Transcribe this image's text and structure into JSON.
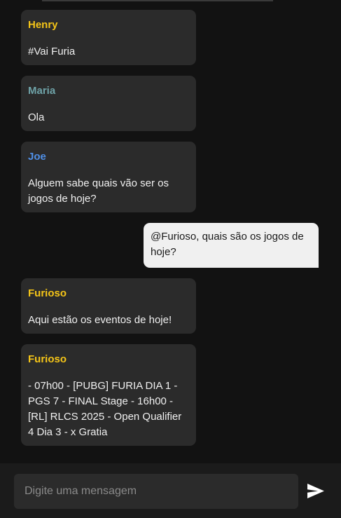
{
  "messages": [
    {
      "author": "Henry",
      "author_color": "#f5c518",
      "text": "#Vai Furia"
    },
    {
      "author": "Maria",
      "author_color": "#6fa3a8",
      "text": "Ola"
    },
    {
      "author": "Joe",
      "author_color": "#4f8fe6",
      "text": "Alguem sabe quais vão ser os\njogos de hoje?"
    },
    {
      "author": "",
      "author_color": "",
      "text": "@Furioso, quais são os jogos de\nhoje?"
    },
    {
      "author": "Furioso",
      "author_color": "#f5c518",
      "text": "Aqui estão os eventos de hoje!"
    },
    {
      "author": "Furioso",
      "author_color": "#f5c518",
      "text": "- 07h00 - [PUBG] FURIA DIA 1 -\nPGS 7 - FINAL Stage - 16h00 -\n[RL] RLCS 2025 - Open Qualifier\n4 Dia 3 - x Gratia"
    }
  ],
  "composer": {
    "placeholder": "Digite uma mensagem",
    "value": ""
  },
  "icons": {
    "send": "send-icon"
  },
  "colors": {
    "background": "#121212",
    "bubble": "#2b2b2b",
    "own_bubble": "#f0f0f0"
  }
}
